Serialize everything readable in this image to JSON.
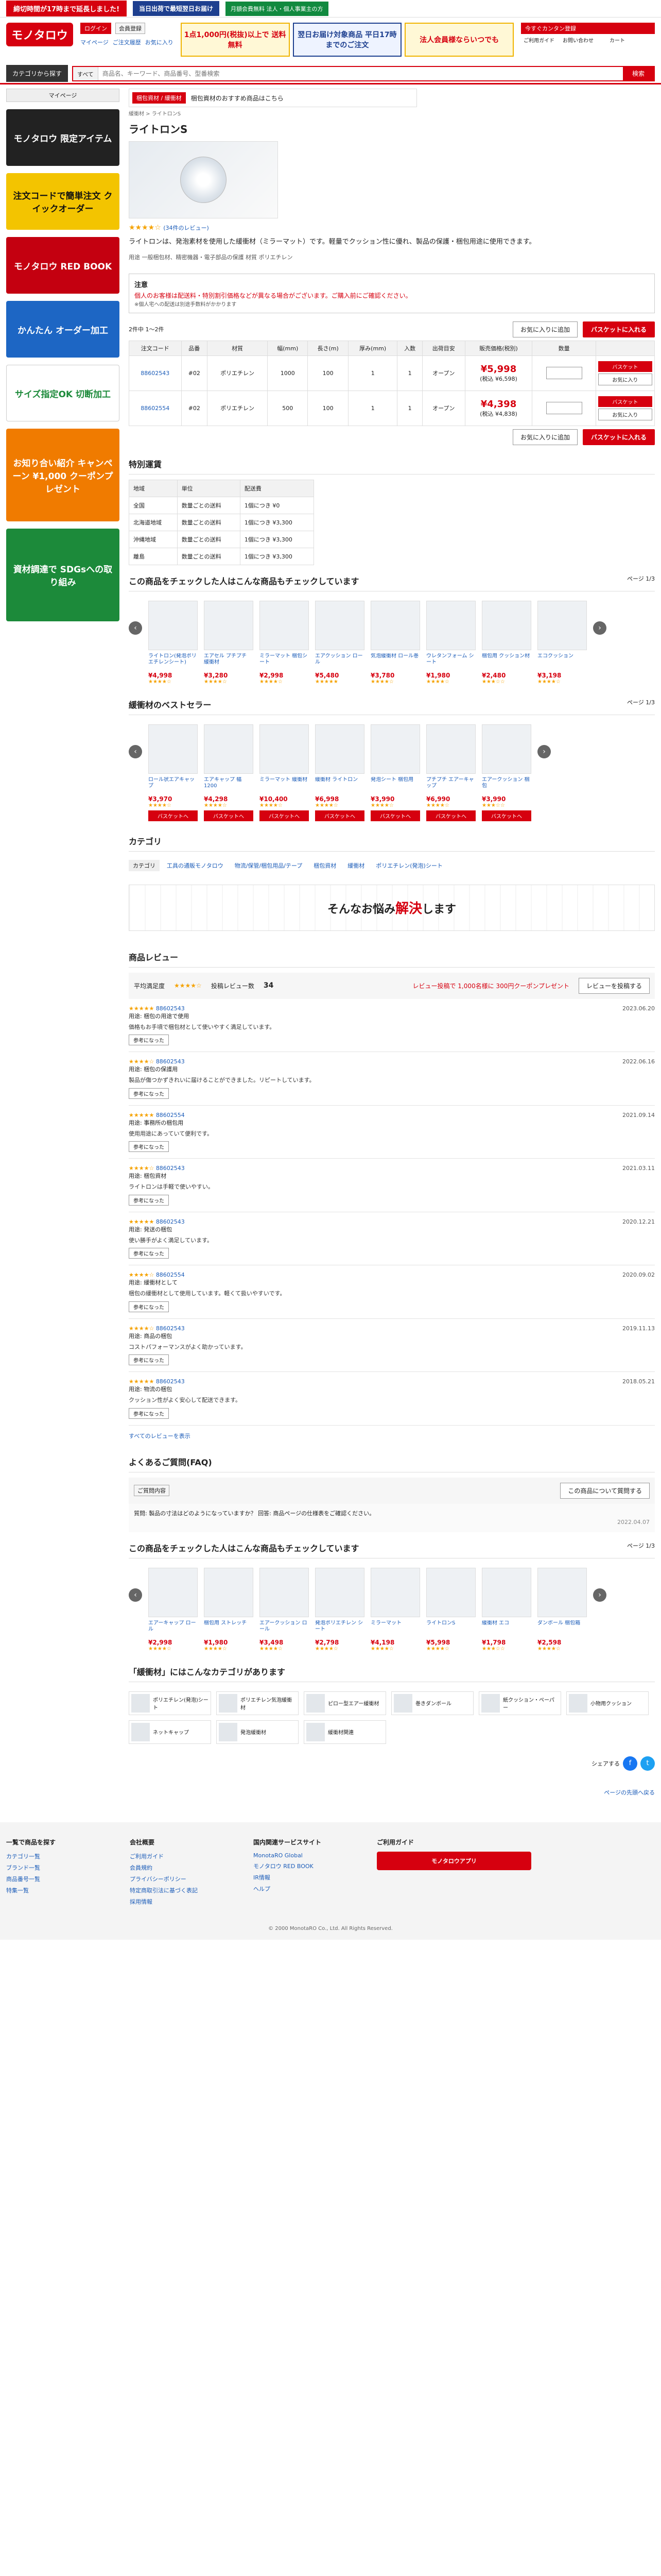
{
  "topbar": {
    "promo_red": "締切時間が17時まで延長しました!",
    "promo_blue": "当日出荷で最短翌日お届け",
    "promo_green": "月額会費無料 法人・個人事業主の方"
  },
  "header": {
    "logo": "モノタロウ",
    "login": "ログイン",
    "register": "会員登録",
    "links": [
      "マイページ",
      "ご注文履歴",
      "お気に入り"
    ],
    "banner1": "1点1,000円(税抜)以上で 送料無料",
    "banner2": "翌日お届け対象商品 平日17時までのご注文",
    "banner3": "法人会員様ならいつでも",
    "register_cta": "今すぐカンタン登録",
    "right_links": [
      "ご利用ガイド",
      "お問い合わせ",
      "カート"
    ]
  },
  "search": {
    "category_label": "カテゴリから探す",
    "scope": "すべて",
    "placeholder": "商品名、キーワード、商品番号、型番検索",
    "go": "検索"
  },
  "sidebar": {
    "title": "マイページ",
    "banners": [
      "モノタロウ 限定アイテム",
      "注文コードで簡単注文 クイックオーダー",
      "モノタロウ RED BOOK",
      "かんたん オーダー加工",
      "サイズ指定OK 切断加工",
      "お知り合い紹介 キャンペーン ¥1,000 クーポンプレゼント",
      "資材調達で SDGsへの取り組み"
    ]
  },
  "product": {
    "breadcrumb": "緩衝材 > ライトロンS",
    "promo_tag": "梱包資材 / 緩衝材",
    "promo_text": "梱包資材のおすすめ商品はこちら",
    "title": "ライトロンS",
    "rating": "★★★★☆",
    "review_count": "(34件のレビュー)",
    "description": "ライトロンは、発泡素材を使用した緩衝材（ミラーマット）です。軽量でクッション性に優れ、製品の保護・梱包用途に使用できます。",
    "tags": "用途 一般梱包材、精密機器・電子部品の保護 材質 ポリエチレン",
    "image_label": "ライトロンS"
  },
  "notice": {
    "title": "注意",
    "red": "個人のお客様は配送料・特別割引価格などが異なる場合がございます。ご購入前にご確認ください。",
    "small": "※個人宅への配送は別途手数料がかかります"
  },
  "actions": {
    "fav": "お気に入りに追加",
    "cart": "バスケットに入れる",
    "count": "2件中 1～2件"
  },
  "spec_table": {
    "headers": [
      "注文コード",
      "品番",
      "材質",
      "幅(mm)",
      "長さ(m)",
      "厚み(mm)",
      "入数",
      "出荷目安",
      "販売価格(税別)",
      "数量",
      ""
    ],
    "rows": [
      {
        "code": "88602543",
        "model": "#02",
        "material": "ポリエチレン",
        "width": "1000",
        "length": "100",
        "thick": "1",
        "qty": "1",
        "ship": "オープン",
        "price": "¥5,998",
        "pricetax": "(税込 ¥6,598)"
      },
      {
        "code": "88602554",
        "model": "#02",
        "material": "ポリエチレン",
        "width": "500",
        "length": "100",
        "thick": "1",
        "qty": "1",
        "ship": "オープン",
        "price": "¥4,398",
        "pricetax": "(税込 ¥4,838)"
      }
    ],
    "mini_cart": "バスケット",
    "mini_fav": "お気に入り"
  },
  "shipping": {
    "title": "特別運賃",
    "headers": [
      "地域",
      "単位",
      "配送費"
    ],
    "rows": [
      [
        "全国",
        "数量ごとの送料",
        "1個につき ¥0"
      ],
      [
        "北海道地域",
        "数量ごとの送料",
        "1個につき ¥3,300"
      ],
      [
        "沖縄地域",
        "数量ごとの送料",
        "1個につき ¥3,300"
      ],
      [
        "離島",
        "数量ごとの送料",
        "1個につき ¥3,300"
      ]
    ]
  },
  "also_viewed": {
    "title": "この商品をチェックした人はこんな商品もチェックしています",
    "page": "ページ 1/3",
    "items": [
      {
        "name": "ライトロン(発泡ポリエチレンシート)",
        "price": "¥4,998",
        "stars": "★★★★☆"
      },
      {
        "name": "エアセル プチプチ 緩衝材",
        "price": "¥3,280",
        "stars": "★★★★☆"
      },
      {
        "name": "ミラーマット 梱包シート",
        "price": "¥2,998",
        "stars": "★★★★☆"
      },
      {
        "name": "エアクッション ロール",
        "price": "¥5,480",
        "stars": "★★★★★"
      },
      {
        "name": "気泡緩衝材 ロール巻",
        "price": "¥3,780",
        "stars": "★★★★☆"
      },
      {
        "name": "ウレタンフォーム シート",
        "price": "¥1,980",
        "stars": "★★★★☆"
      },
      {
        "name": "梱包用 クッション材",
        "price": "¥2,480",
        "stars": "★★★☆☆"
      },
      {
        "name": "エコクッション",
        "price": "¥3,198",
        "stars": "★★★★☆"
      }
    ]
  },
  "bestsellers": {
    "title": "緩衝材のベストセラー",
    "page": "ページ 1/3",
    "items": [
      {
        "name": "ロール状エアキャップ",
        "price": "¥3,970",
        "stars": "★★★★☆"
      },
      {
        "name": "エアキャップ 幅1200",
        "price": "¥4,298",
        "stars": "★★★★☆"
      },
      {
        "name": "ミラーマット 緩衝材",
        "price": "¥10,400",
        "stars": "★★★★☆"
      },
      {
        "name": "緩衝材 ライトロン",
        "price": "¥6,998",
        "stars": "★★★★☆"
      },
      {
        "name": "発泡シート 梱包用",
        "price": "¥3,990",
        "stars": "★★★★☆"
      },
      {
        "name": "プチプチ エアーキャップ",
        "price": "¥6,990",
        "stars": "★★★★☆"
      },
      {
        "name": "エアークッション 梱包",
        "price": "¥3,990",
        "stars": "★★★☆☆"
      }
    ],
    "cart": "バスケットへ"
  },
  "category": {
    "title": "カテゴリ",
    "chips": [
      "カテゴリ",
      "工具の通販モノタロウ",
      "物流/保管/梱包用品/テープ",
      "梱包資材",
      "緩衝材",
      "ポリエチレン(発泡)シート"
    ]
  },
  "trouble_banner": {
    "text1": "そんなお悩み",
    "text2": "解決",
    "text3": "します"
  },
  "reviews": {
    "title": "商品レビュー",
    "avg_label": "平均満足度",
    "avg_stars": "★★★★☆",
    "count_label": "投稿レビュー数",
    "count": "34",
    "coupon": "レビュー投稿で 1,000名様に 300円クーポンプレゼント",
    "write": "レビューを投稿する",
    "items": [
      {
        "stars": "★★★★★",
        "sku": "88602543",
        "meta": "用途: 梱包の用途で使用",
        "date": "2023.06.20",
        "body": "価格もお手頃で梱包材として使いやすく満足しています。"
      },
      {
        "stars": "★★★★☆",
        "sku": "88602543",
        "meta": "用途: 梱包の保護用",
        "date": "2022.06.16",
        "body": "製品が傷つかずきれいに届けることができました。リピートしています。"
      },
      {
        "stars": "★★★★★",
        "sku": "88602554",
        "meta": "用途: 事務所の梱包用",
        "date": "2021.09.14",
        "body": "使用用途にあっていて便利です。"
      },
      {
        "stars": "★★★★☆",
        "sku": "88602543",
        "meta": "用途: 梱包資材",
        "date": "2021.03.11",
        "body": "ライトロンは手軽で使いやすい。"
      },
      {
        "stars": "★★★★★",
        "sku": "88602543",
        "meta": "用途: 発送の梱包",
        "date": "2020.12.21",
        "body": "使い勝手がよく満足しています。"
      },
      {
        "stars": "★★★★☆",
        "sku": "88602554",
        "meta": "用途: 緩衝材として",
        "date": "2020.09.02",
        "body": "梱包の緩衝材として使用しています。軽くて扱いやすいです。"
      },
      {
        "stars": "★★★★☆",
        "sku": "88602543",
        "meta": "用途: 商品の梱包",
        "date": "2019.11.13",
        "body": "コストパフォーマンスがよく助かっています。"
      },
      {
        "stars": "★★★★★",
        "sku": "88602543",
        "meta": "用途: 物流の梱包",
        "date": "2018.05.21",
        "body": "クッション性がよく安心して配送できます。"
      }
    ],
    "helpful": "参考になった",
    "more": "すべてのレビューを表示"
  },
  "faq": {
    "title": "よくあるご質問(FAQ)",
    "question_placeholder": "ご質問内容",
    "ask": "この商品について質問する",
    "body": "質問: 製品の寸法はどのようになっていますか？ 回答: 商品ページの仕様表をご確認ください。",
    "date": "2022.04.07"
  },
  "also_viewed2": {
    "title": "この商品をチェックした人はこんな商品もチェックしています",
    "page": "ページ 1/3",
    "items": [
      {
        "name": "エアーキャップ ロール",
        "price": "¥2,998",
        "stars": "★★★★☆"
      },
      {
        "name": "梱包用 ストレッチ",
        "price": "¥1,980",
        "stars": "★★★★☆"
      },
      {
        "name": "エアークッション ロール",
        "price": "¥3,498",
        "stars": "★★★★☆"
      },
      {
        "name": "発泡ポリエチレン シート",
        "price": "¥2,798",
        "stars": "★★★★☆"
      },
      {
        "name": "ミラーマット",
        "price": "¥4,198",
        "stars": "★★★★☆"
      },
      {
        "name": "ライトロンS",
        "price": "¥5,998",
        "stars": "★★★★☆"
      },
      {
        "name": "緩衝材 エコ",
        "price": "¥1,798",
        "stars": "★★★☆☆"
      },
      {
        "name": "ダンボール 梱包箱",
        "price": "¥2,598",
        "stars": "★★★★☆"
      }
    ]
  },
  "related": {
    "title": "「緩衝材」にはこんなカテゴリがあります",
    "items": [
      "ポリエチレン(発泡)シート",
      "ポリエチレン気泡緩衝材",
      "ピロー型エアー緩衝材",
      "巻きダンボール",
      "紙クッション・ペーパー",
      "小物用クッション",
      "ネットキャップ",
      "発泡緩衝材",
      "緩衝材関連"
    ]
  },
  "share": {
    "label": "シェアする"
  },
  "pagetop": "ページの先頭へ戻る",
  "footer": {
    "col1_title": "一覧で商品を探す",
    "col1": [
      "カテゴリ一覧",
      "ブランド一覧",
      "商品番号一覧",
      "特集一覧"
    ],
    "col2_title": "会社概要",
    "col2": [
      "ご利用ガイド",
      "会員規約",
      "プライバシーポリシー",
      "特定商取引法に基づく表記",
      "採用情報"
    ],
    "col3_title": "国内関連サービスサイト",
    "col3": [
      "MonotaRO Global",
      "モノタロウ RED BOOK",
      "IR情報",
      "ヘルプ"
    ],
    "app_title": "ご利用ガイド",
    "app": "モノタロウアプリ"
  },
  "copyright": "© 2000 MonotaRO Co., Ltd. All Rights Reserved."
}
